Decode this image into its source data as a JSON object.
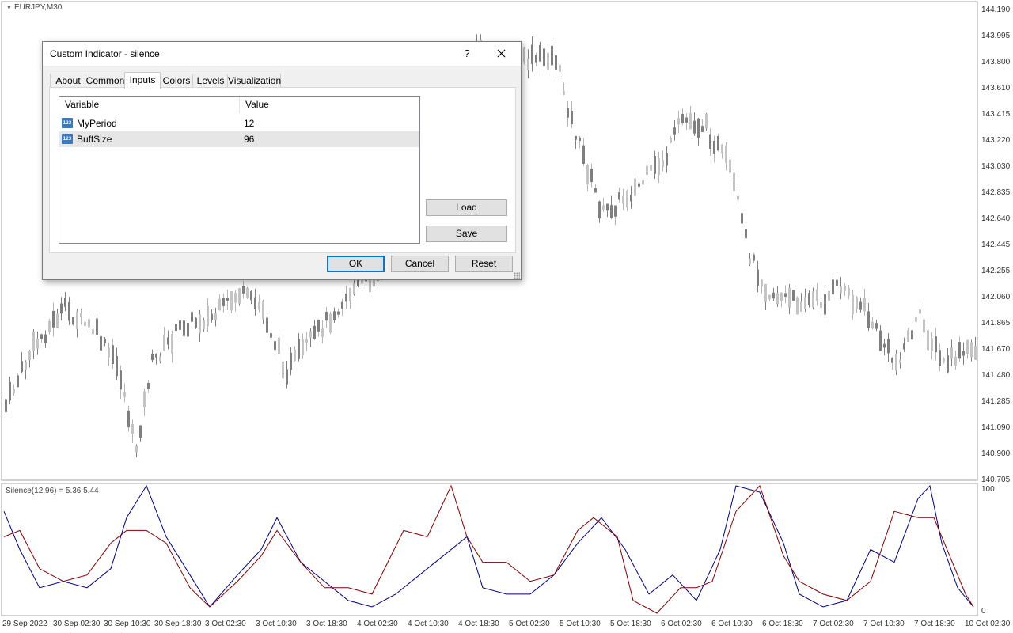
{
  "chart": {
    "symbol": "EURJPY,M30",
    "price_axis": [
      "144.190",
      "143.995",
      "143.800",
      "143.610",
      "143.415",
      "143.220",
      "143.030",
      "142.835",
      "142.640",
      "142.445",
      "142.255",
      "142.060",
      "141.865",
      "141.670",
      "141.480",
      "141.285",
      "141.090",
      "140.900",
      "140.705"
    ],
    "time_axis": [
      "29 Sep 2022",
      "30 Sep 02:30",
      "30 Sep 10:30",
      "30 Sep 18:30",
      "3 Oct 02:30",
      "3 Oct 10:30",
      "3 Oct 18:30",
      "4 Oct 02:30",
      "4 Oct 10:30",
      "4 Oct 18:30",
      "5 Oct 02:30",
      "5 Oct 10:30",
      "5 Oct 18:30",
      "6 Oct 02:30",
      "6 Oct 10:30",
      "6 Oct 18:30",
      "7 Oct 02:30",
      "7 Oct 10:30",
      "7 Oct 18:30",
      "10 Oct 02:30"
    ],
    "candle_color": "#7f7f7f"
  },
  "indicator": {
    "title": "Silence(12,96) =  5.36  5.44",
    "scale_top": "100",
    "scale_bottom": "0",
    "line1_color": "#00007f",
    "line2_color": "#7f0000"
  },
  "dialog": {
    "title": "Custom Indicator - silence",
    "help": "?",
    "tabs": [
      "About",
      "Common",
      "Inputs",
      "Colors",
      "Levels",
      "Visualization"
    ],
    "active_tab": "Inputs",
    "columns": {
      "variable": "Variable",
      "value": "Value"
    },
    "params": [
      {
        "name": "MyPeriod",
        "value": "12",
        "icon": "123"
      },
      {
        "name": "BuffSize",
        "value": "96",
        "icon": "123"
      }
    ],
    "buttons": {
      "load": "Load",
      "save": "Save",
      "ok": "OK",
      "cancel": "Cancel",
      "reset": "Reset"
    }
  }
}
